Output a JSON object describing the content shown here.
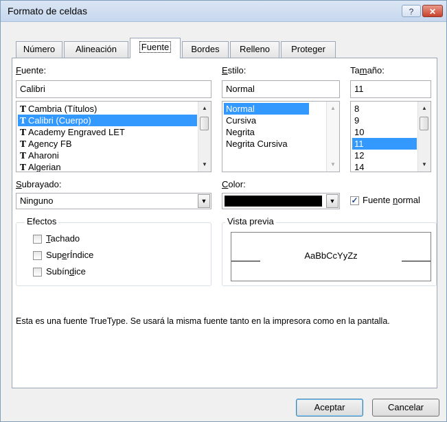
{
  "window": {
    "title": "Formato de celdas",
    "help_glyph": "?",
    "close_glyph": "✕"
  },
  "tabs": [
    {
      "label": "Número"
    },
    {
      "label": "Alineación"
    },
    {
      "label": "Fuente"
    },
    {
      "label": "Bordes"
    },
    {
      "label": "Relleno"
    },
    {
      "label": "Proteger"
    }
  ],
  "active_tab": "Fuente",
  "font": {
    "label_hotkey": "F",
    "label_rest": "uente:",
    "value": "Calibri",
    "items": [
      "Cambria (Títulos)",
      "Calibri (Cuerpo)",
      "Academy Engraved LET",
      "Agency FB",
      "Aharoni",
      "Algerian"
    ],
    "selected": "Calibri (Cuerpo)",
    "icon_glyph": "T"
  },
  "style": {
    "label_hotkey": "E",
    "label_rest": "stilo:",
    "value": "Normal",
    "items": [
      "Normal",
      "Cursiva",
      "Negrita",
      "Negrita Cursiva"
    ],
    "selected": "Normal"
  },
  "size": {
    "label_pre": "Ta",
    "label_hotkey": "m",
    "label_rest": "año:",
    "value": "11",
    "items": [
      "8",
      "9",
      "10",
      "11",
      "12",
      "14"
    ],
    "selected": "11"
  },
  "underline": {
    "label_hotkey": "S",
    "label_rest": "ubrayado:",
    "value": "Ninguno"
  },
  "color": {
    "label_hotkey": "C",
    "label_rest": "olor:",
    "swatch": "#000000"
  },
  "normal_font": {
    "label_pre": "Fuente ",
    "label_hotkey": "n",
    "label_rest": "ormal",
    "checked": true
  },
  "effects": {
    "title": "Efectos",
    "items": [
      {
        "pre": "",
        "hotkey": "T",
        "rest": "achado",
        "checked": false
      },
      {
        "pre": "Sup",
        "hotkey": "e",
        "rest": "rÍndice",
        "checked": false
      },
      {
        "pre": "Subín",
        "hotkey": "d",
        "rest": "ice",
        "checked": false
      }
    ]
  },
  "preview": {
    "title": "Vista previa",
    "sample": "AaBbCcYyZz"
  },
  "info_text": "Esta es una fuente TrueType. Se usará la misma fuente tanto en la impresora como en la pantalla.",
  "buttons": {
    "ok": "Aceptar",
    "cancel": "Cancelar"
  },
  "glyphs": {
    "up": "▲",
    "down": "▼",
    "check": "✓"
  }
}
